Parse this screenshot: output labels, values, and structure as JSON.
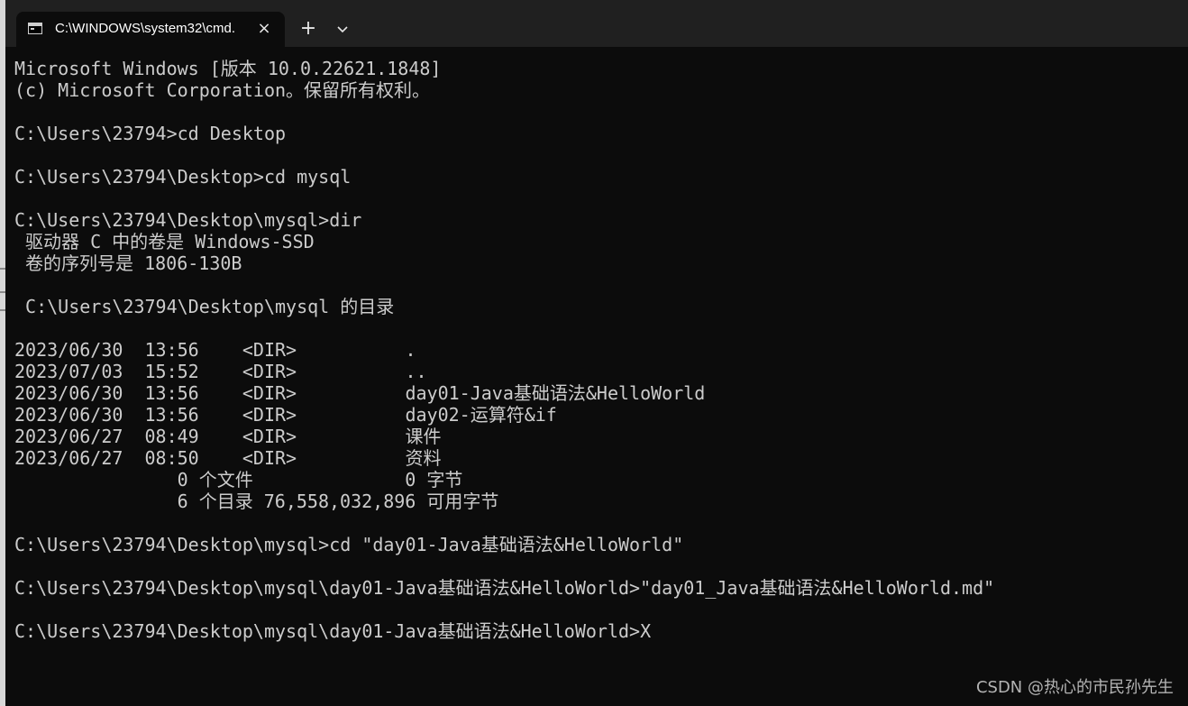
{
  "window": {
    "tab_title": "C:\\WINDOWS\\system32\\cmd.",
    "close_symbol": "×",
    "new_tab_symbol": "+",
    "icon": "cmd-icon"
  },
  "terminal": {
    "lines": [
      "Microsoft Windows [版本 10.0.22621.1848]",
      "(c) Microsoft Corporation。保留所有权利。",
      "",
      "C:\\Users\\23794>cd Desktop",
      "",
      "C:\\Users\\23794\\Desktop>cd mysql",
      "",
      "C:\\Users\\23794\\Desktop\\mysql>dir",
      " 驱动器 C 中的卷是 Windows-SSD",
      " 卷的序列号是 1806-130B",
      "",
      " C:\\Users\\23794\\Desktop\\mysql 的目录",
      "",
      "2023/06/30  13:56    <DIR>          .",
      "2023/07/03  15:52    <DIR>          ..",
      "2023/06/30  13:56    <DIR>          day01-Java基础语法&HelloWorld",
      "2023/06/30  13:56    <DIR>          day02-运算符&if",
      "2023/06/27  08:49    <DIR>          课件",
      "2023/06/27  08:50    <DIR>          资料",
      "               0 个文件              0 字节",
      "               6 个目录 76,558,032,896 可用字节",
      "",
      "C:\\Users\\23794\\Desktop\\mysql>cd \"day01-Java基础语法&HelloWorld\"",
      "",
      "C:\\Users\\23794\\Desktop\\mysql\\day01-Java基础语法&HelloWorld>\"day01_Java基础语法&HelloWorld.md\"",
      "",
      "C:\\Users\\23794\\Desktop\\mysql\\day01-Java基础语法&HelloWorld>X"
    ]
  },
  "watermark": "CSDN @热心的市民孙先生",
  "colors": {
    "background": "#0c0c0c",
    "titlebar": "#202020",
    "text": "#cccccc"
  }
}
